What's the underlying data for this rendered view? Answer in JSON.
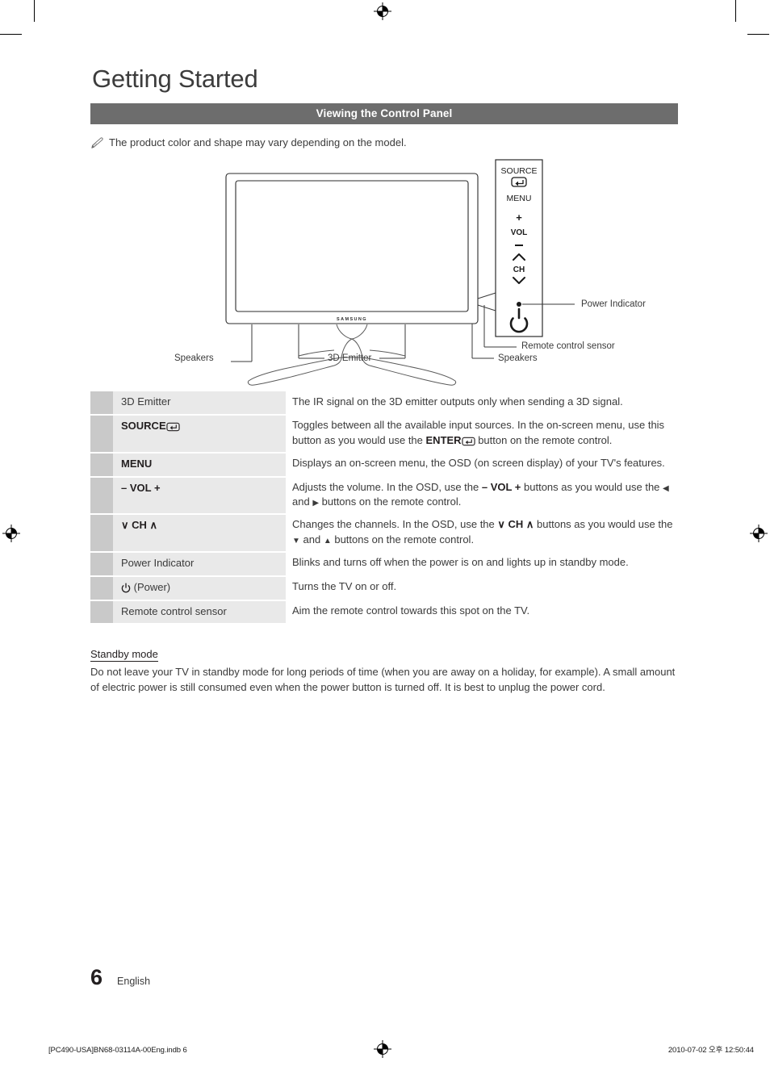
{
  "document": {
    "chapter_title": "Getting Started",
    "section_bar": "Viewing the Control Panel",
    "note": "The product color and shape may vary depending on the model.",
    "note_icon": "pencil-note-icon"
  },
  "figure": {
    "panel_buttons": [
      "SOURCE",
      "MENU",
      "+",
      "VOL",
      "–",
      "CH"
    ],
    "source_label": "SOURCE",
    "menu_label": "MENU",
    "vol_plus": "+",
    "vol_label": "VOL",
    "vol_minus": "–",
    "ch_label": "CH",
    "brand": "SAMSUNG",
    "callouts": {
      "power_indicator": "Power Indicator",
      "remote_sensor": "Remote control sensor",
      "speakers_left": "Speakers",
      "speakers_right": "Speakers",
      "emitter": "3D Emitter"
    }
  },
  "spec_table": {
    "rows": [
      {
        "term": "3D Emitter",
        "term_style": "plain",
        "term_icon": "",
        "desc_html": "The IR signal on the 3D emitter outputs only when sending a 3D signal."
      },
      {
        "term": "SOURCE",
        "term_style": "strong",
        "term_icon": "enter-icon",
        "desc_html": "Toggles between all the available input sources. In the on-screen menu, use this button as you would use the <b>ENTER</b> <ENTER_ICON> button on the remote control."
      },
      {
        "term": "MENU",
        "term_style": "strong",
        "term_icon": "",
        "desc_html": "Displays an on-screen menu, the OSD (on screen display) of your TV's features."
      },
      {
        "term": "– VOL +",
        "term_style": "strong",
        "term_icon": "",
        "desc_html": "Adjusts the volume. In the OSD, use the <b>– VOL +</b> buttons as you would use the <LEFT> and <RIGHT> buttons on the remote control."
      },
      {
        "term": "∨ CH ∧",
        "term_style": "strong",
        "term_icon": "",
        "desc_html": "Changes the channels. In the OSD, use the <b>∨ CH ∧</b> buttons as you would use the <DOWN> and <UP> buttons on the remote control."
      },
      {
        "term": "Power Indicator",
        "term_style": "plain",
        "term_icon": "",
        "desc_html": "Blinks and turns off when the power is on and lights up in standby mode."
      },
      {
        "term": "(Power)",
        "term_style": "plain",
        "term_icon": "power-icon",
        "desc_html": "Turns the TV on or off."
      },
      {
        "term": "Remote control sensor",
        "term_style": "plain",
        "term_icon": "",
        "desc_html": "Aim the remote control towards this spot on the TV."
      }
    ]
  },
  "standby": {
    "heading": "Standby mode",
    "body": "Do not leave your TV in standby mode for long periods of time (when you are away on a holiday, for example). A small amount of electric power is still consumed even when the power button is turned off. It is best to unplug the power cord."
  },
  "footer": {
    "page_number": "6",
    "language": "English"
  },
  "slug": {
    "file": "[PC490-USA]BN68-03114A-00Eng.indb   6",
    "timestamp": "2010-07-02   오후 12:50:44"
  },
  "colors": {
    "section_bar": "#6d6d6d",
    "term_cell": "#e9e9e9",
    "swatch_cell": "#c9c9c9",
    "text": "#3a3a3a"
  }
}
